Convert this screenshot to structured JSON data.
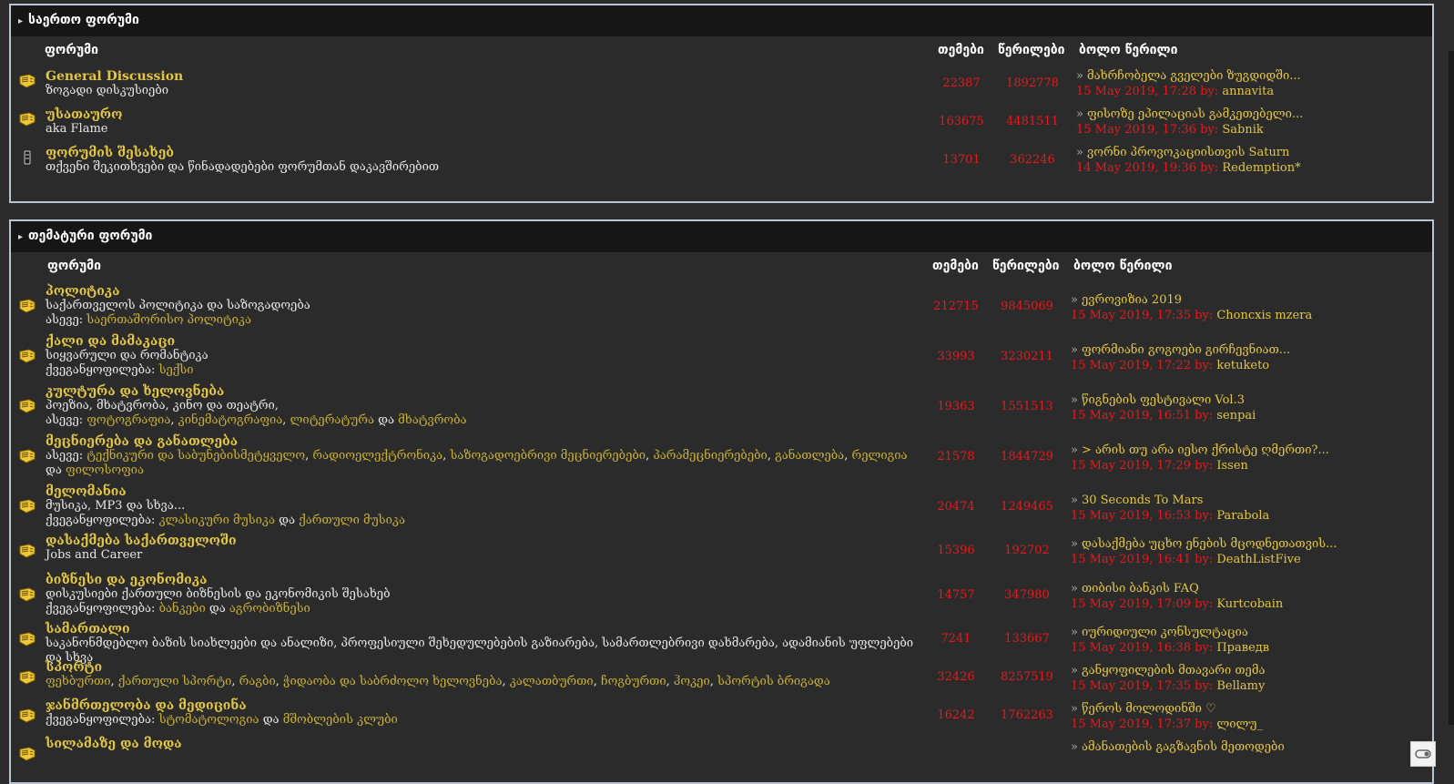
{
  "general": {
    "title": "საერთო ფორუმი",
    "headers": {
      "forum": "ფორუმი",
      "topics": "თემები",
      "posts": "წერილები",
      "last": "ბოლო წერილი"
    },
    "forums": [
      {
        "title": "General Discussion",
        "desc": "ზოგადი დისკუსიები",
        "topics": "22387",
        "posts": "1892778",
        "last_topic": "მახრჩობელა გველები ზუგდიდში...",
        "last_date": "15 May 2019, 17:28 by:",
        "last_user": "annavita"
      },
      {
        "title": "უსათაურო",
        "desc": "aka Flame",
        "topics": "163675",
        "posts": "4481511",
        "last_topic": "ფისოზე ეპილაციას გამკეთებელი...",
        "last_date": "15 May 2019, 17:36 by:",
        "last_user": "Sabnik"
      },
      {
        "title": "ფორუმის შესახებ",
        "desc": "თქვენი შეკითხვები და წინადადებები ფორუმთან დაკავშირებით",
        "topics": "13701",
        "posts": "362246",
        "last_topic": "ვორნი პროვოკაციისთვის Saturn",
        "last_date": "14 May 2019, 19:36 by:",
        "last_user": "Redemption*"
      }
    ]
  },
  "thematic": {
    "title": "თემატური ფორუმი",
    "headers": {
      "forum": "ფორუმი",
      "topics": "თემები",
      "posts": "წერილები",
      "last": "ბოლო წერილი"
    },
    "forums": [
      {
        "title": "პოლიტიკა",
        "desc": "საქართველოს პოლიტიკა და საზოგადოება",
        "sub_prefix": "ასევე:",
        "subs": [
          "საერთაშორისო პოლიტიკა"
        ],
        "topics": "212715",
        "posts": "9845069",
        "last_topic": "ევროვიზია 2019",
        "last_date": "15 May 2019, 17:35 by:",
        "last_user": "Choncxis mzera"
      },
      {
        "title": "ქალი და მამაკაცი",
        "desc": "სიყვარული და რომანტიკა",
        "sub_prefix": "ქვეგანყოფილება:",
        "subs": [
          "სექსი"
        ],
        "topics": "33993",
        "posts": "3230211",
        "last_topic": "ფორმიანი გოგოები გირჩევნიათ...",
        "last_date": "15 May 2019, 17:22 by:",
        "last_user": "ketuketo"
      },
      {
        "title": "კულტურა და ხელოვნება",
        "desc": "პოეზია, მხატვრობა, კინო და თეატრი,",
        "sub_prefix": "ასევე:",
        "subs": [
          "ფოტოგრაფია",
          "კინემატოგრაფია",
          "ლიტერატურა",
          "მხატვრობა"
        ],
        "topics": "19363",
        "posts": "1551513",
        "last_topic": "წიგნების ფესტივალი Vol.3",
        "last_date": "15 May 2019, 16:51 by:",
        "last_user": "senpai"
      },
      {
        "title": "მეცნიერება და განათლება",
        "desc": "",
        "sub_prefix": "ასევე:",
        "subs": [
          "ტექნიკური და საბუნებისმეტყველო",
          "რადიოელექტრონიკა",
          "საზოგადოებრივი მეცნიერებები",
          "პარამეცნიერებები",
          "განათლება",
          "რელიგია",
          "ფილოსოფია"
        ],
        "topics": "21578",
        "posts": "1844729",
        "last_topic": "> არის თუ არა იესო ქრისტე ღმერთი?...",
        "last_date": "15 May 2019, 17:29 by:",
        "last_user": "Issen"
      },
      {
        "title": "მელომანია",
        "desc": "მუსიკა, MP3 და სხვა...",
        "sub_prefix": "ქვეგანყოფილება:",
        "subs": [
          "კლასიკური მუსიკა",
          "ქართული მუსიკა"
        ],
        "topics": "20474",
        "posts": "1249465",
        "last_topic": "30 Seconds To Mars",
        "last_date": "15 May 2019, 16:53 by:",
        "last_user": "Parabola"
      },
      {
        "title": "დასაქმება საქართველოში",
        "desc": "Jobs and Career",
        "sub_prefix": "",
        "subs": [],
        "topics": "15396",
        "posts": "192702",
        "last_topic": "დასაქმება უცხო ენების მცოდნეთათვის...",
        "last_date": "15 May 2019, 16:41 by:",
        "last_user": "DeathListFive"
      },
      {
        "title": "ბიზნესი და ეკონომიკა",
        "desc": "დისკუსიები ქართული ბიზნესის და ეკონომიკის შესახებ",
        "sub_prefix": "ქვეგანყოფილება:",
        "subs": [
          "ბანკები",
          "აგრობიზნესი"
        ],
        "topics": "14757",
        "posts": "347980",
        "last_topic": "თიბისი ბანკის FAQ",
        "last_date": "15 May 2019, 17:09 by:",
        "last_user": "Kurtcobain"
      },
      {
        "title": "სამართალი",
        "desc": "საკანონმდებლო ბაზის სიახლეები და ანალიზი, პროფესიული შეხედულებების გაზიარება, სამართლებრივი დახმარება, ადამიანის უფლებები და სხვა",
        "sub_prefix": "",
        "subs": [],
        "topics": "7241",
        "posts": "133667",
        "last_topic": "იურიდიული კონსულტაცია",
        "last_date": "15 May 2019, 16:38 by:",
        "last_user": "Праведв"
      },
      {
        "title": "სპორტი",
        "desc": "",
        "sub_prefix": "",
        "subs": [
          "ფეხბურთი",
          "ქართული სპორტი",
          "რაგბი",
          "ჭიდაობა და საბრძოლო ხელოვნება",
          "კალათბურთი",
          "ჩოგბურთი",
          "ჰოკეი",
          "სპორტის ბრიგადა"
        ],
        "topics": "32426",
        "posts": "8257519",
        "last_topic": "განყოფილების მთავარი თემა",
        "last_date": "15 May 2019, 17:35 by:",
        "last_user": "Bellamy"
      },
      {
        "title": "ჯანმრთელობა და მედიცინა",
        "desc": "",
        "sub_prefix": "ქვეგანყოფილება:",
        "subs": [
          "სტომატოლოგია",
          "მშობლების კლუბი"
        ],
        "topics": "16242",
        "posts": "1762263",
        "last_topic": "წეროს მოლოდინში ♡",
        "last_date": "15 May 2019, 17:37 by:",
        "last_user": "ლილუ_"
      },
      {
        "title": "სილამაზე და მოდა",
        "desc": "",
        "sub_prefix": "",
        "subs": [],
        "topics": "",
        "posts": "",
        "last_topic": "ამანათების გაგზავნის მეთოდები",
        "last_date": "",
        "last_user": ""
      }
    ]
  }
}
